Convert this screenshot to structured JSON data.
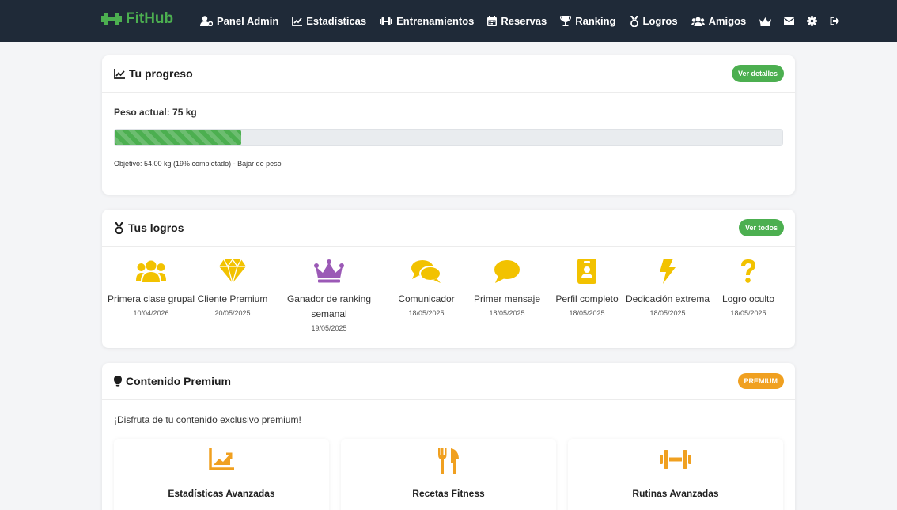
{
  "colors": {
    "navbar": "#1f2a38",
    "accent_green": "#4caf50",
    "premium_orange": "#f0a020",
    "gold": "#f2c200",
    "purple": "#9b59b6"
  },
  "navbar": {
    "brand": "FitHub",
    "items": [
      {
        "label": "Panel Admin",
        "icon": "user-gear-icon"
      },
      {
        "label": "Estadísticas",
        "icon": "chart-line-icon"
      },
      {
        "label": "Entrenamientos",
        "icon": "dumbbell-icon"
      },
      {
        "label": "Reservas",
        "icon": "calendar-icon"
      },
      {
        "label": "Ranking",
        "icon": "trophy-icon"
      },
      {
        "label": "Logros",
        "icon": "medal-icon"
      },
      {
        "label": "Amigos",
        "icon": "users-icon"
      }
    ],
    "icon_items": [
      "crown-icon",
      "envelope-icon",
      "gear-icon",
      "sign-out-icon"
    ]
  },
  "progress": {
    "title": "Tu progreso",
    "button": "Ver detalles",
    "current_weight": "Peso actual: 75 kg",
    "fill_percent": 19,
    "objective": "Objetivo: 54.00 kg (19% completado) - Bajar de peso"
  },
  "achievements": {
    "title": "Tus logros",
    "button": "Ver todos",
    "items": [
      {
        "name": "Primera clase grupal",
        "date": "10/04/2026",
        "icon": "users-icon"
      },
      {
        "name": "Cliente Premium",
        "date": "20/05/2025",
        "icon": "diamond-icon"
      },
      {
        "name": "Ganador de ranking semanal",
        "date": "19/05/2025",
        "icon": "crown-icon"
      },
      {
        "name": "Comunicador",
        "date": "18/05/2025",
        "icon": "comments-icon"
      },
      {
        "name": "Primer mensaje",
        "date": "18/05/2025",
        "icon": "comment-icon"
      },
      {
        "name": "Perfil completo",
        "date": "18/05/2025",
        "icon": "id-badge-icon"
      },
      {
        "name": "Dedicación extrema",
        "date": "18/05/2025",
        "icon": "bolt-icon"
      },
      {
        "name": "Logro oculto",
        "date": "18/05/2025",
        "icon": "question-icon"
      }
    ]
  },
  "premium": {
    "title": "Contenido Premium",
    "badge": "PREMIUM",
    "intro": "¡Disfruta de tu contenido exclusivo premium!",
    "cards": [
      {
        "title": "Estadísticas Avanzadas",
        "icon": "chart-area-icon"
      },
      {
        "title": "Recetas Fitness",
        "icon": "utensils-icon"
      },
      {
        "title": "Rutinas Avanzadas",
        "icon": "dumbbell-icon"
      }
    ]
  }
}
